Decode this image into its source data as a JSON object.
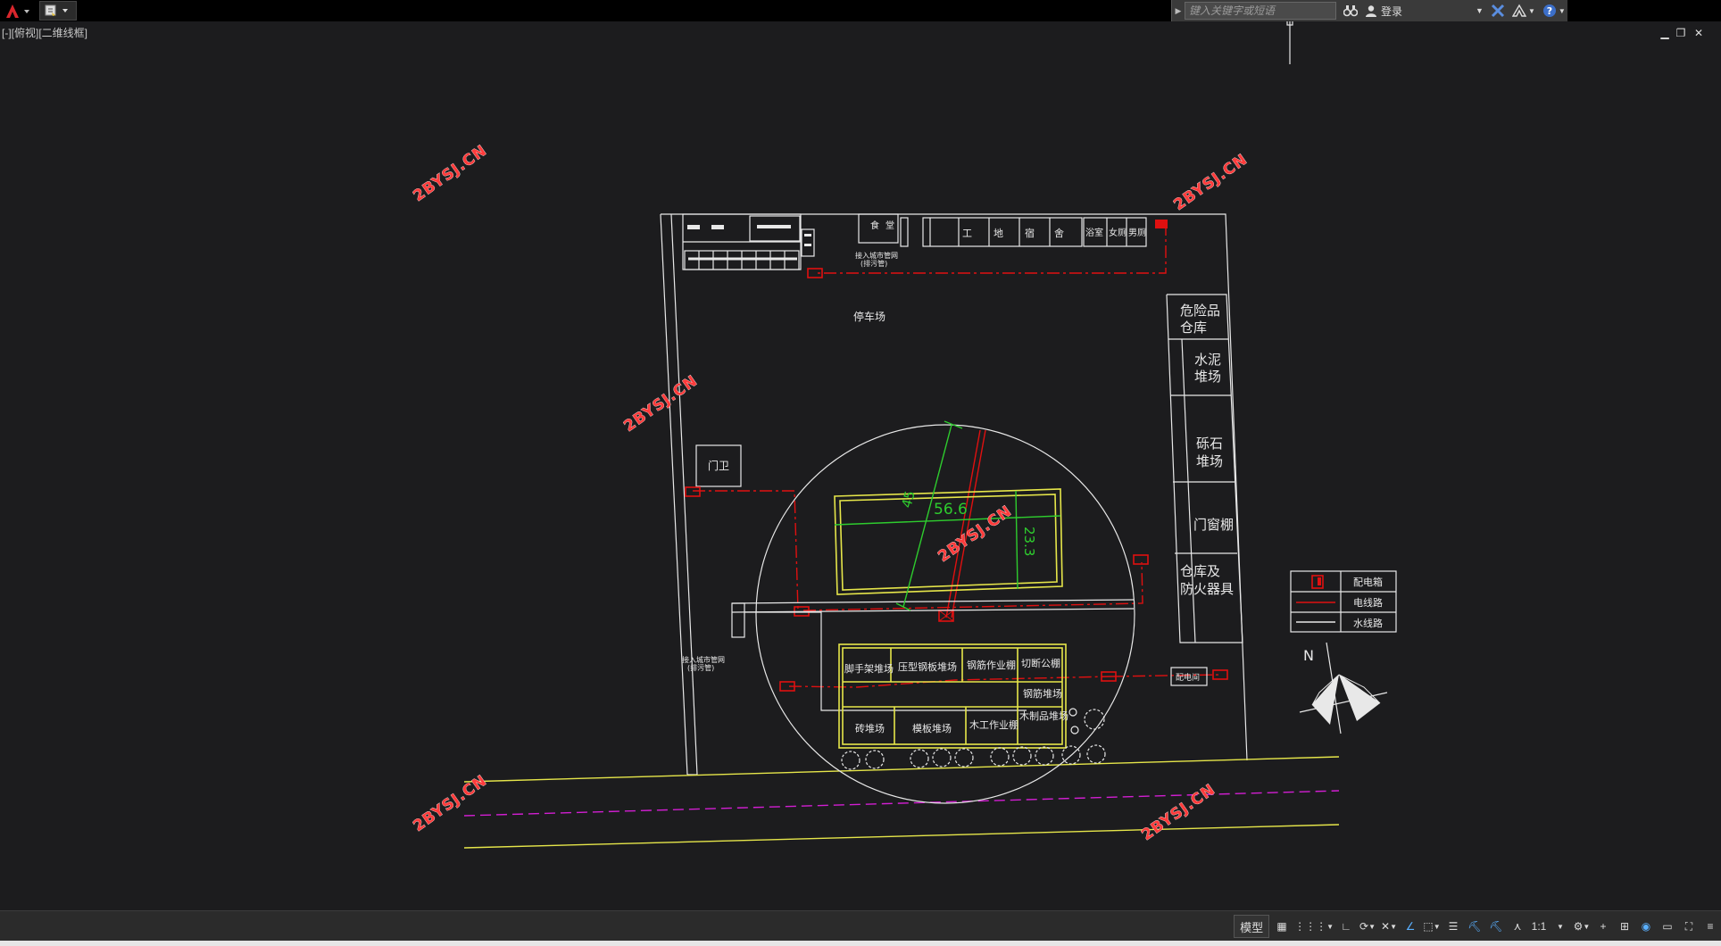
{
  "titlebar": {
    "search_placeholder": "键入关键字或短语",
    "login_label": "登录"
  },
  "viewport": {
    "label": "[-][俯视][二维线框]"
  },
  "watermarks": [
    "2BYSJ.CN",
    "2BYSJ.CN",
    "2BYSJ.CN",
    "2BYSJ.CN",
    "2BYSJ.CN",
    "2BYSJ.CN"
  ],
  "drawing": {
    "top_rooms": [
      "食",
      "堂",
      "工",
      "地",
      "宿",
      "舍",
      "浴室",
      "女厕",
      "男厕"
    ],
    "sewer_note_top": [
      "接入城市管网",
      "(排污管)"
    ],
    "sewer_note_left": [
      "接入城市管网",
      "(排污管)"
    ],
    "parking": "停车场",
    "gate": "门卫",
    "right_column": [
      "危险品",
      "仓库",
      "水泥",
      "堆场",
      "砾石",
      "堆场",
      "门窗棚",
      "仓库及",
      "防火器具"
    ],
    "dimensions": {
      "width": "56.6",
      "height": "23.3",
      "diag": "45"
    },
    "yards_top": [
      "脚手架堆场",
      "压型钢板堆场",
      "钢筋作业棚",
      "切断公棚"
    ],
    "yard_middle": "钢筋堆场",
    "yards_bottom": [
      "砖堆场",
      "模板堆场",
      "木工作业棚",
      "木制品堆场"
    ],
    "distribution_room": "配电间",
    "north": "N"
  },
  "legend": {
    "items": [
      "配电箱",
      "电线路",
      "水线路"
    ]
  },
  "statusbar": {
    "model_label": "模型",
    "scale_label": "1:1"
  },
  "colors": {
    "background": "#1c1c1e",
    "line_white": "#e8e8e8",
    "line_red": "#e01010",
    "line_yellow": "#e6e64a",
    "line_green": "#2ecc2e",
    "line_magenta": "#d21ed2",
    "watermark": "#e8303a"
  }
}
